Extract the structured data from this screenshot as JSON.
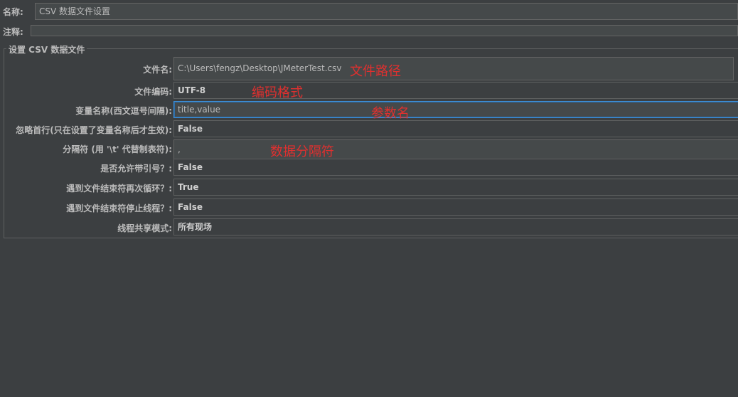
{
  "header": {
    "name_label": "名称:",
    "name_value": "CSV 数据文件设置",
    "comment_label": "注释:",
    "comment_value": ""
  },
  "section": {
    "title": "设置 CSV 数据文件"
  },
  "form": {
    "filename_label": "文件名:",
    "filename_value": "C:\\Users\\fengz\\Desktop\\JMeterTest.csv",
    "encoding_label": "文件编码:",
    "encoding_value": "UTF-8",
    "varnames_label": "变量名称(西文逗号间隔):",
    "varnames_value": "title,value",
    "ignore_first_label": "忽略首行(只在设置了变量名称后才生效):",
    "ignore_first_value": "False",
    "delimiter_label": "分隔符 (用 '\\t' 代替制表符):",
    "delimiter_value": ",",
    "quoted_label": "是否允许带引号？:",
    "quoted_value": "False",
    "recycle_label": "遇到文件结束符再次循环？:",
    "recycle_value": "True",
    "stop_thread_label": "遇到文件结束符停止线程？:",
    "stop_thread_value": "False",
    "sharing_label": "线程共享模式:",
    "sharing_value": "所有现场"
  },
  "annotations": {
    "filename": "文件路径",
    "encoding": "编码格式",
    "varnames": "参数名",
    "delimiter": "数据分隔符"
  },
  "colors": {
    "background": "#3c3f41",
    "field": "#45494a",
    "focus_border": "#3d8fd8",
    "annotation": "#e0302f"
  }
}
